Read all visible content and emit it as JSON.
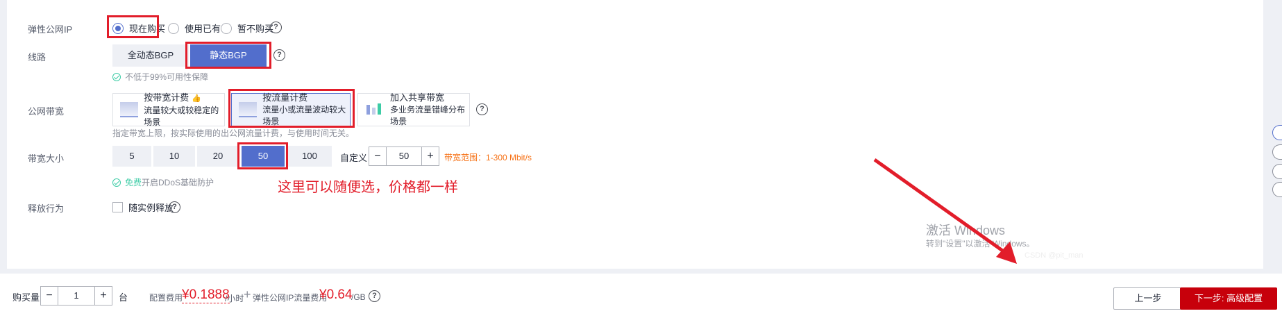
{
  "eip": {
    "label": "弹性公网IP",
    "options": [
      "现在购买",
      "使用已有",
      "暂不购买"
    ]
  },
  "line": {
    "label": "线路",
    "options": [
      "全动态BGP",
      "静态BGP"
    ],
    "hint": "不低于99%可用性保障"
  },
  "billing": {
    "label": "公网带宽",
    "cards": [
      {
        "title": "按带宽计费",
        "desc": "流量较大或较稳定的场景",
        "badge": "👍"
      },
      {
        "title": "按流量计费",
        "desc": "流量小或流量波动较大场景"
      },
      {
        "title": "加入共享带宽",
        "desc": "多业务流量错峰分布场景"
      }
    ],
    "note": "指定带宽上限，按实际使用的出公网流量计费，与使用时间无关。"
  },
  "bandwidth": {
    "label": "带宽大小",
    "options": [
      "5",
      "10",
      "20",
      "50",
      "100"
    ],
    "custom_label": "自定义",
    "custom_value": "50",
    "range": "带宽范围：1-300 Mbit/s",
    "hint_green": "免费",
    "hint_rest": "开启DDoS基础防护"
  },
  "annotation": "这里可以随便选，价格都一样",
  "release": {
    "label": "释放行为",
    "checkbox": "随实例释放"
  },
  "footer": {
    "qty_label": "购买量",
    "qty_value": "1",
    "qty_unit": "台",
    "config_label": "配置费用",
    "config_price": "¥0.1888",
    "config_unit": "/小时",
    "plus": "+",
    "eip_label": "弹性公网IP流量费用",
    "eip_price": "¥0.64",
    "eip_unit": "/GB",
    "prev": "上一步",
    "next": "下一步: 高级配置"
  },
  "watermark": {
    "line1": "激活 Windows",
    "line2": "转到\"设置\"以激活 Windows。",
    "csdn": "CSDN @pit_man"
  },
  "colors": {
    "accent": "#526ecc",
    "danger": "#e21d2a",
    "primary_btn": "#c7000b"
  }
}
